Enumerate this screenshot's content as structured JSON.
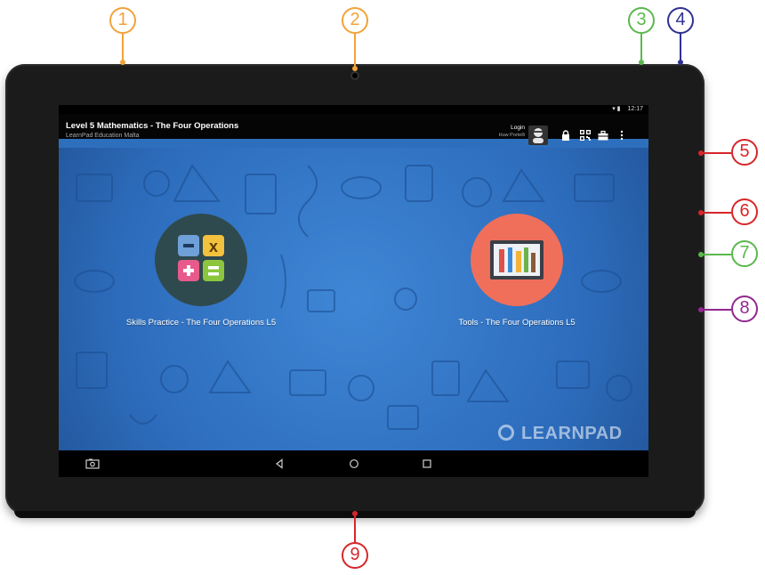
{
  "status_bar": {
    "time": "12:17"
  },
  "app_bar": {
    "title": "Level 5 Mathematics - The Four Operations",
    "subtitle": "LearnPad Education Malta",
    "login_label": "Login",
    "user_name": "Huw Portelli",
    "icons": [
      "avatar-icon",
      "lock-icon",
      "qr-code-icon",
      "toolbox-icon",
      "overflow-menu-icon"
    ]
  },
  "apps": [
    {
      "label": "Skills Practice - The Four Operations L5",
      "icon": "math-operations-icon",
      "color": "#2f4a4e"
    },
    {
      "label": "Tools - The Four Operations L5",
      "icon": "tools-icon",
      "color": "#ef6f5b"
    }
  ],
  "watermark": "LEARNPAD",
  "nav_bar": {
    "icons": [
      "screenshot-icon",
      "back-icon",
      "home-icon",
      "recents-icon"
    ]
  },
  "callouts": [
    {
      "number": "1",
      "color": "#f3a23a"
    },
    {
      "number": "2",
      "color": "#f3a23a"
    },
    {
      "number": "3",
      "color": "#5bb84d"
    },
    {
      "number": "4",
      "color": "#2e3192"
    },
    {
      "number": "5",
      "color": "#d7262b"
    },
    {
      "number": "6",
      "color": "#d7262b"
    },
    {
      "number": "7",
      "color": "#5bb84d"
    },
    {
      "number": "8",
      "color": "#92278f"
    },
    {
      "number": "9",
      "color": "#d7262b"
    }
  ]
}
